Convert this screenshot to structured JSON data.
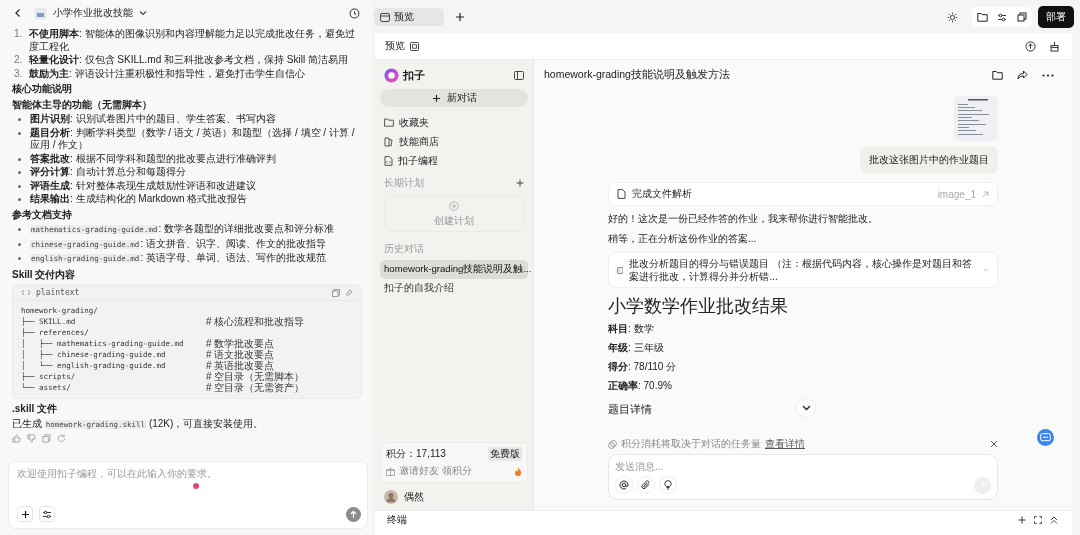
{
  "left_panel": {
    "title": "小学作业批改技能",
    "content": [
      {
        "kind": "numbered",
        "number": "1.",
        "text": "**不使用脚本**: 智能体的图像识别和内容理解能力足以完成批改任务，避免过度工程化"
      },
      {
        "kind": "numbered",
        "number": "2.",
        "text": "**轻量化设计**: 仅包含 SKILL.md 和三科批改参考文档，保持 Skill 简洁易用"
      },
      {
        "kind": "numbered",
        "number": "3.",
        "text": "**鼓励为主**: 评语设计注重积极性和指导性，避免打击学生自信心"
      },
      {
        "kind": "heading",
        "text": "核心功能说明"
      },
      {
        "kind": "heading",
        "text": "智能体主导的功能（无需脚本）"
      },
      {
        "kind": "bullet",
        "text": "**图片识别**: 识别试卷图片中的题目、学生答案、书写内容"
      },
      {
        "kind": "bullet",
        "text": "**题目分析**: 判断学科类型（数学 / 语文 / 英语）和题型（选择 / 填空 / 计算 / 应用 / 作文）"
      },
      {
        "kind": "bullet",
        "text": "**答案批改**: 根据不同学科和题型的批改要点进行准确评判"
      },
      {
        "kind": "bullet",
        "text": "**评分计算**: 自动计算总分和每题得分"
      },
      {
        "kind": "bullet",
        "text": "**评语生成**: 针对整体表现生成鼓励性评语和改进建议"
      },
      {
        "kind": "bullet",
        "text": "**结果输出**: 生成结构化的 Markdown 格式批改报告"
      },
      {
        "kind": "heading",
        "text": "参考文档支持"
      },
      {
        "kind": "code_bullet",
        "code": "mathematics-grading-guide.md",
        "text": ": 数学各题型的详细批改要点和评分标准"
      },
      {
        "kind": "code_bullet",
        "code": "chinese-grading-guide.md",
        "text": ": 语文拼音、识字、阅读、作文的批改指导"
      },
      {
        "kind": "code_bullet",
        "code": "english-grading-guide.md",
        "text": ": 英语字母、单词、语法、写作的批改规范"
      },
      {
        "kind": "heading",
        "text": "Skill 交付内容"
      },
      {
        "kind": "codeblock",
        "language": "plaintext",
        "rows": [
          {
            "path": "homework-grading/"
          },
          {
            "path": "├── SKILL.md",
            "comment": "# 核心流程和批改指导"
          },
          {
            "path": "├── references/"
          },
          {
            "path": "│   ├── mathematics-grading-guide.md",
            "comment": "# 数学批改要点"
          },
          {
            "path": "│   ├── chinese-grading-guide.md",
            "comment": "# 语文批改要点"
          },
          {
            "path": "│   └── english-grading-guide.md",
            "comment": "# 英语批改要点"
          },
          {
            "path": "├── scripts/",
            "comment": "# 空目录（无需脚本）"
          },
          {
            "path": "└── assets/",
            "comment": "# 空目录（无需资产）"
          }
        ]
      },
      {
        "kind": "heading",
        "text": ".skill 文件"
      },
      {
        "kind": "code_paragraph",
        "before": "已生成 ",
        "code": "homework-grading.skill",
        "after": " (12K)，可直接安装使用。"
      }
    ],
    "input": {
      "placeholder": "欢迎使用扣子编程，可以在此输入你的要求。"
    }
  },
  "tabs": [
    {
      "label": "预览",
      "selected": true
    }
  ],
  "deploy_button": "部署",
  "preview": {
    "title": "预览",
    "sidebar": {
      "brand": "扣子",
      "new_chat": "新对话",
      "nav": [
        {
          "label": "收藏夹",
          "kind": "folder"
        },
        {
          "label": "技能商店",
          "kind": "store"
        },
        {
          "label": "扣子编程",
          "kind": "code"
        }
      ],
      "plans_title": "长期计划",
      "create_plan": "创建计划",
      "history_title": "历史对话",
      "history": [
        {
          "label": "homework-grading技能说明及触...",
          "selected": true
        },
        {
          "label": "扣子的自我介绍",
          "selected": false
        }
      ],
      "points": "积分：17,113",
      "plan_badge": "免费版",
      "invite": "邀请好友 领积分",
      "user": "偶然"
    },
    "chat": {
      "title": "homework-grading技能说明及触发方法",
      "user_image": {
        "kind": "picture"
      },
      "user_message": "批改这张图片中的作业题目",
      "file_card": {
        "label": "完成文件解析",
        "file": "image_1"
      },
      "replies": [
        "好的！这次是一份已经作答的作业，我来帮你进行智能批改。",
        "稍等，正在分析这份作业的答案..."
      ],
      "tool_card": "批改分析题目的得分与错误题目 （注：根据代码内容，核心操作是对题目和答案进行批改，计算得分并分析错...",
      "result_title": "小学数学作业批改结果",
      "fields": [
        "**科目**: 数学",
        "**年级**: 三年级",
        "**得分**: 78/110 分",
        "**正确率**: 70.9%"
      ],
      "section_title": "题目详情",
      "notice": "积分消耗将取决于对话的任务量",
      "notice_link": "查看详情",
      "input": {
        "placeholder": "发送消息..."
      }
    }
  },
  "terminal": {
    "label": "终端"
  }
}
